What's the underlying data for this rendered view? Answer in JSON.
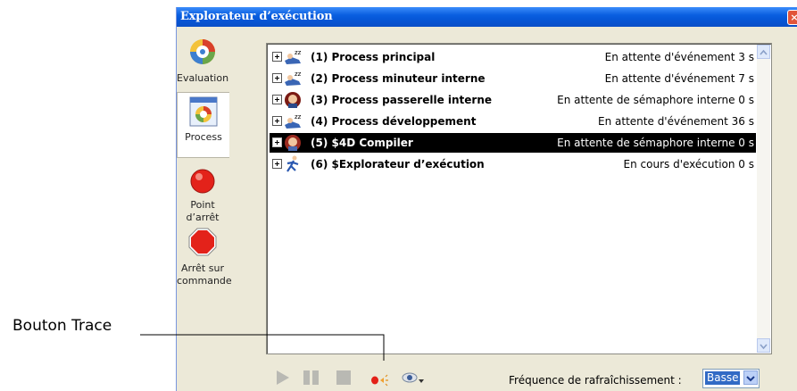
{
  "window": {
    "title": "Explorateur d’exécution",
    "close_glyph": "×"
  },
  "sidebar": {
    "items": [
      {
        "label": "Evaluation",
        "icon": "evaluation-icon"
      },
      {
        "label": "Process",
        "icon": "process-icon",
        "active": true
      },
      {
        "label": "Point d’arrêt",
        "icon": "breakpoint-icon"
      },
      {
        "label_line1": "Arrêt sur",
        "label_line2": "commande",
        "icon": "stop-sign-icon"
      }
    ]
  },
  "processes": [
    {
      "name": "(1) Process principal",
      "state": "En attente d'événement  3 s",
      "icon": "sleeping-process-icon"
    },
    {
      "name": "(2) Process minuteur interne",
      "state": "En attente d'événement  7 s",
      "icon": "sleeping-process-icon"
    },
    {
      "name": "(3) Process passerelle interne",
      "state": "En attente de sémaphore interne  0 s",
      "icon": "semaphore-process-icon"
    },
    {
      "name": "(4) Process développement",
      "state": "En attente d'événement  36 s",
      "icon": "sleeping-process-icon"
    },
    {
      "name": "(5) $4D Compiler",
      "state": "En attente de sémaphore interne  0 s",
      "icon": "semaphore-process-icon",
      "selected": true
    },
    {
      "name": "(6) $Explorateur d’exécution",
      "state": "En cours d'exécution  0 s",
      "icon": "running-process-icon"
    }
  ],
  "toolbar": {
    "buttons": [
      "play-icon",
      "pause-icon",
      "stop-icon",
      "trace-icon",
      "watch-eye-icon"
    ],
    "refresh_label": "Fréquence de rafraîchissement :",
    "refresh_value": "Basse"
  },
  "callout": {
    "label": "Bouton Trace"
  },
  "colors": {
    "titlebar": "#0a5fe0",
    "selection": "#000000",
    "select_highlight": "#316ac5",
    "panel": "#ece9d8"
  }
}
